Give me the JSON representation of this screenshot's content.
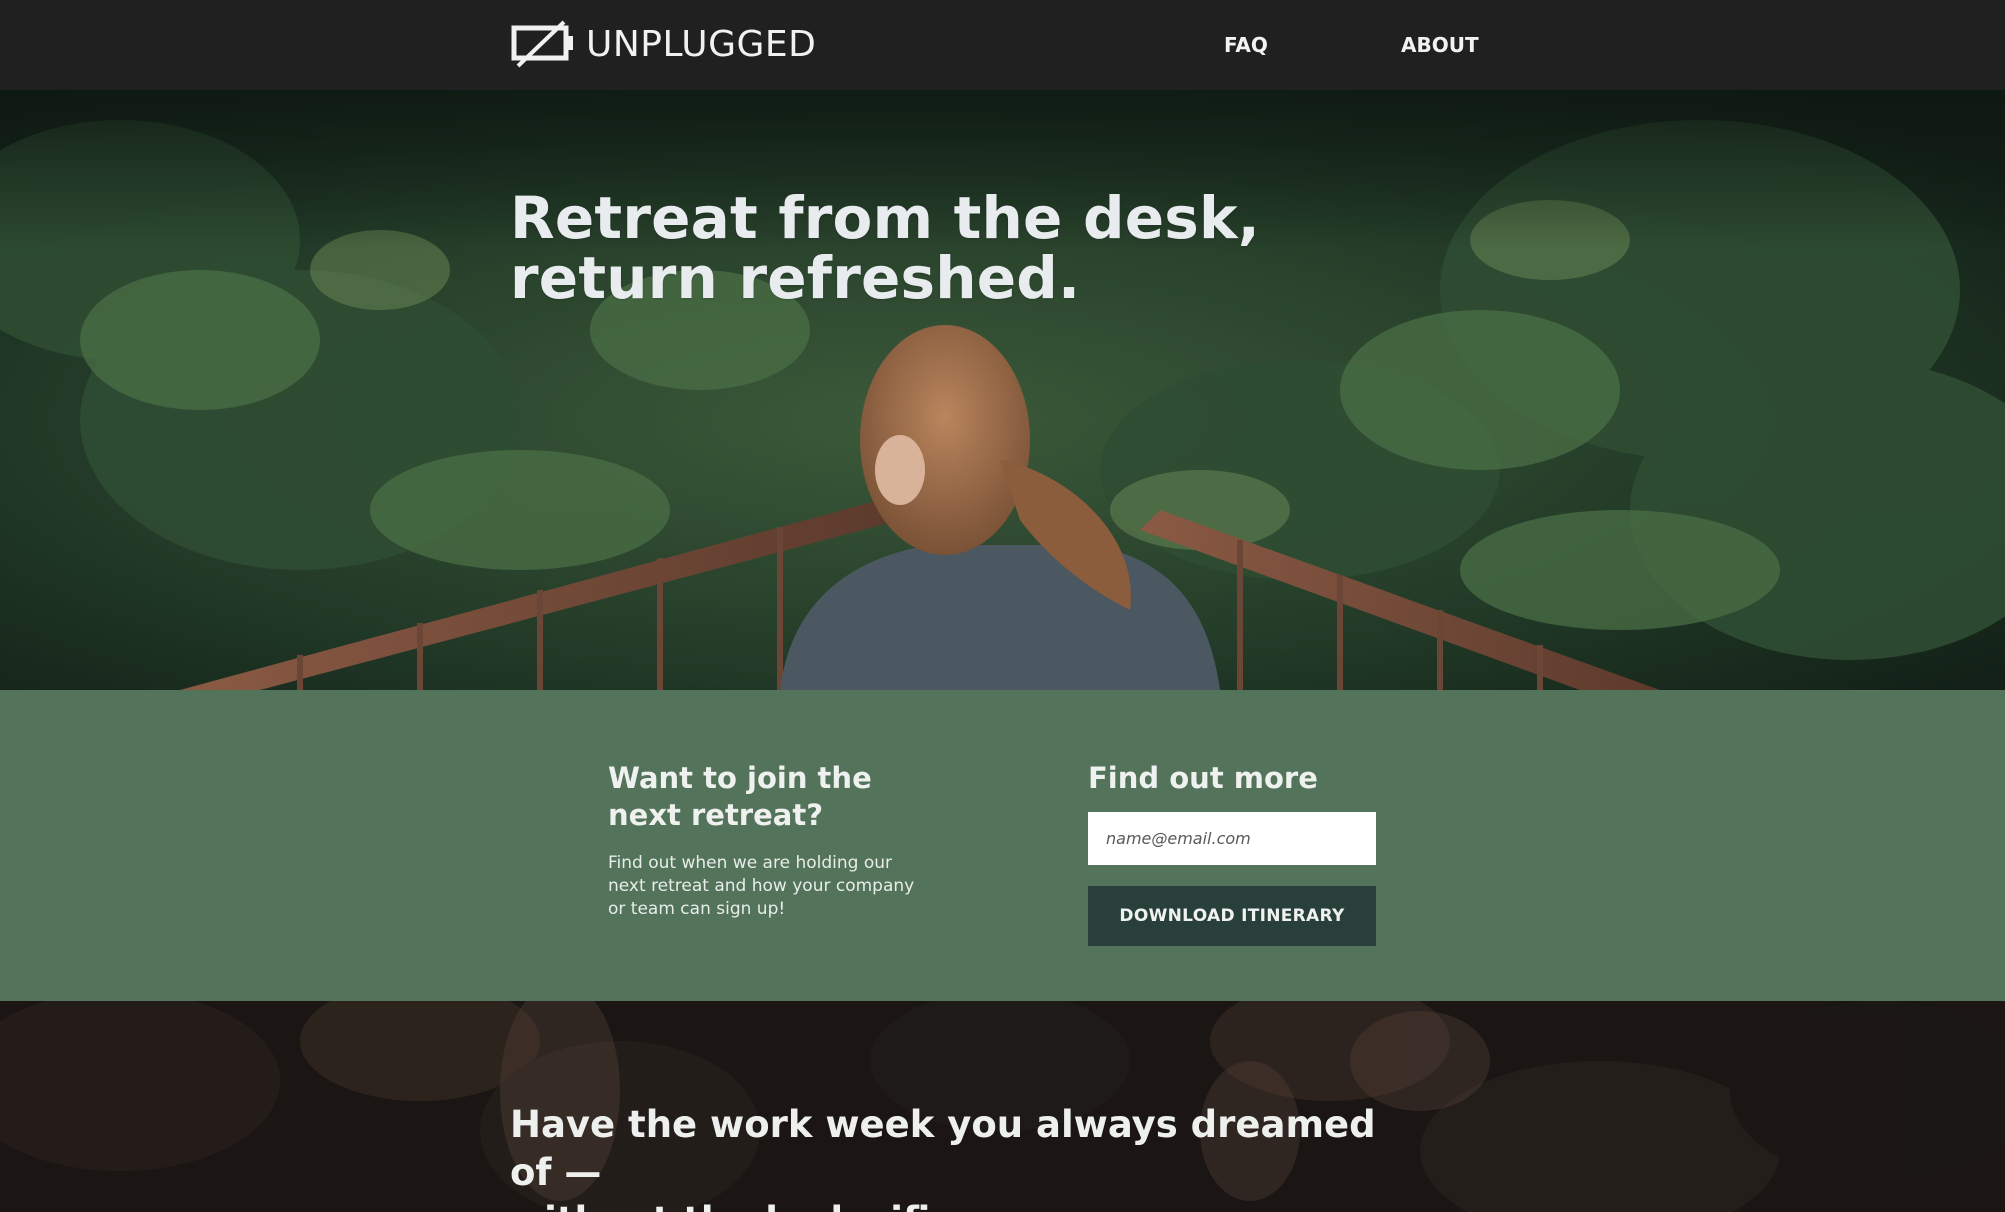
{
  "header": {
    "brand_name": "UNPLUGGED",
    "brand_icon": "unplugged-battery-icon",
    "nav": [
      {
        "label": "FAQ"
      },
      {
        "label": "ABOUT"
      }
    ]
  },
  "hero": {
    "title_line1": "Retreat from the desk,",
    "title_line2": "return refreshed."
  },
  "signup": {
    "left_heading_line1": "Want to join the",
    "left_heading_line2": "next retreat?",
    "left_text": "Find out when we are holding our next retreat and how your company or team can sign up!",
    "right_heading": "Find out more",
    "email_placeholder": "name@email.com",
    "button_label": "DOWNLOAD ITINERARY"
  },
  "bottom": {
    "title_line1": "Have the work week you always dreamed of —",
    "title_line2": "without the bad wifi."
  },
  "colors": {
    "header_bg": "#202020",
    "signup_bg": "#54735b",
    "button_bg": "#29403a",
    "text_light": "#eef1ee"
  }
}
